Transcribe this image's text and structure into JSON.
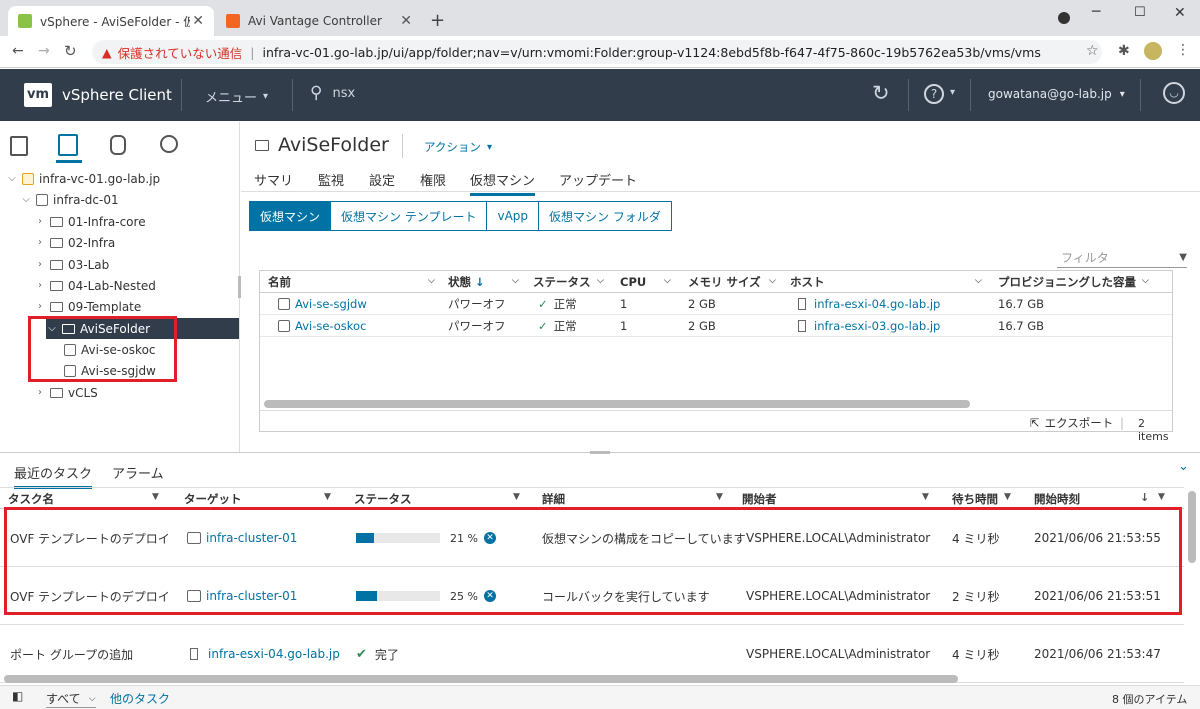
{
  "browser": {
    "tabs": [
      {
        "label": "vSphere - AviSeFolder - 仮想マシン",
        "active": true
      },
      {
        "label": "Avi Vantage Controller",
        "active": false
      }
    ],
    "security_label": "保護されていない通信",
    "url": "infra-vc-01.go-lab.jp/ui/app/folder;nav=v/urn:vmomi:Folder:group-v1124:8ebd5f8b-f647-4f75-860c-19b5762ea53b/vms/vms"
  },
  "header": {
    "logo": "vm",
    "product": "vSphere Client",
    "menu_label": "メニュー",
    "search_value": "nsx",
    "user": "gowatana@go-lab.jp"
  },
  "tree": {
    "items": [
      {
        "label": "infra-vc-01.go-lab.jp"
      },
      {
        "label": "infra-dc-01"
      },
      {
        "label": "01-Infra-core"
      },
      {
        "label": "02-Infra"
      },
      {
        "label": "03-Lab"
      },
      {
        "label": "04-Lab-Nested"
      },
      {
        "label": "09-Template"
      },
      {
        "label": "AviSeFolder"
      },
      {
        "label": "Avi-se-oskoc"
      },
      {
        "label": "Avi-se-sgjdw"
      },
      {
        "label": "vCLS"
      }
    ]
  },
  "object": {
    "title": "AviSeFolder",
    "actions_label": "アクション",
    "tabs": [
      "サマリ",
      "監視",
      "設定",
      "権限",
      "仮想マシン",
      "アップデート"
    ],
    "active_tab": "仮想マシン",
    "subtabs": [
      "仮想マシン",
      "仮想マシン テンプレート",
      "vApp",
      "仮想マシン フォルダ"
    ],
    "filter_placeholder": "フィルタ",
    "columns": [
      "名前",
      "状態",
      "ステータス",
      "CPU",
      "メモリ サイズ",
      "ホスト",
      "プロビジョニングした容量"
    ],
    "rows": [
      {
        "name": "Avi-se-sgjdw",
        "state": "パワーオフ",
        "status": "正常",
        "cpu": "1",
        "mem": "2 GB",
        "host": "infra-esxi-04.go-lab.jp",
        "prov": "16.7 GB"
      },
      {
        "name": "Avi-se-oskoc",
        "state": "パワーオフ",
        "status": "正常",
        "cpu": "1",
        "mem": "2 GB",
        "host": "infra-esxi-03.go-lab.jp",
        "prov": "16.7 GB"
      }
    ],
    "export_label": "エクスポート",
    "items_count": "2 items"
  },
  "tasks": {
    "tabs": [
      "最近のタスク",
      "アラーム"
    ],
    "columns": [
      "タスク名",
      "ターゲット",
      "ステータス",
      "詳細",
      "開始者",
      "待ち時間",
      "開始時刻"
    ],
    "rows": [
      {
        "name": "OVF テンプレートのデプロイ",
        "target": "infra-cluster-01",
        "progress_text": "21 %",
        "progress": 0.21,
        "detail": "仮想マシンの構成をコピーしています",
        "initiator": "VSPHERE.LOCAL\\Administrator",
        "wait": "4 ミリ秒",
        "start": "2021/06/06 21:53:55"
      },
      {
        "name": "OVF テンプレートのデプロイ",
        "target": "infra-cluster-01",
        "progress_text": "25 %",
        "progress": 0.25,
        "detail": "コールバックを実行しています",
        "initiator": "VSPHERE.LOCAL\\Administrator",
        "wait": "2 ミリ秒",
        "start": "2021/06/06 21:53:51"
      },
      {
        "name": "ポート グループの追加",
        "target": "infra-esxi-04.go-lab.jp",
        "status": "完了",
        "detail": "",
        "initiator": "VSPHERE.LOCAL\\Administrator",
        "wait": "4 ミリ秒",
        "start": "2021/06/06 21:53:47"
      }
    ],
    "footer_filter": "すべて",
    "more_tasks": "他のタスク",
    "item_count": "8 個のアイテム"
  },
  "colors": {
    "accent": "#0072a3",
    "header": "#313d4b",
    "highlight": "#e01f2b"
  }
}
